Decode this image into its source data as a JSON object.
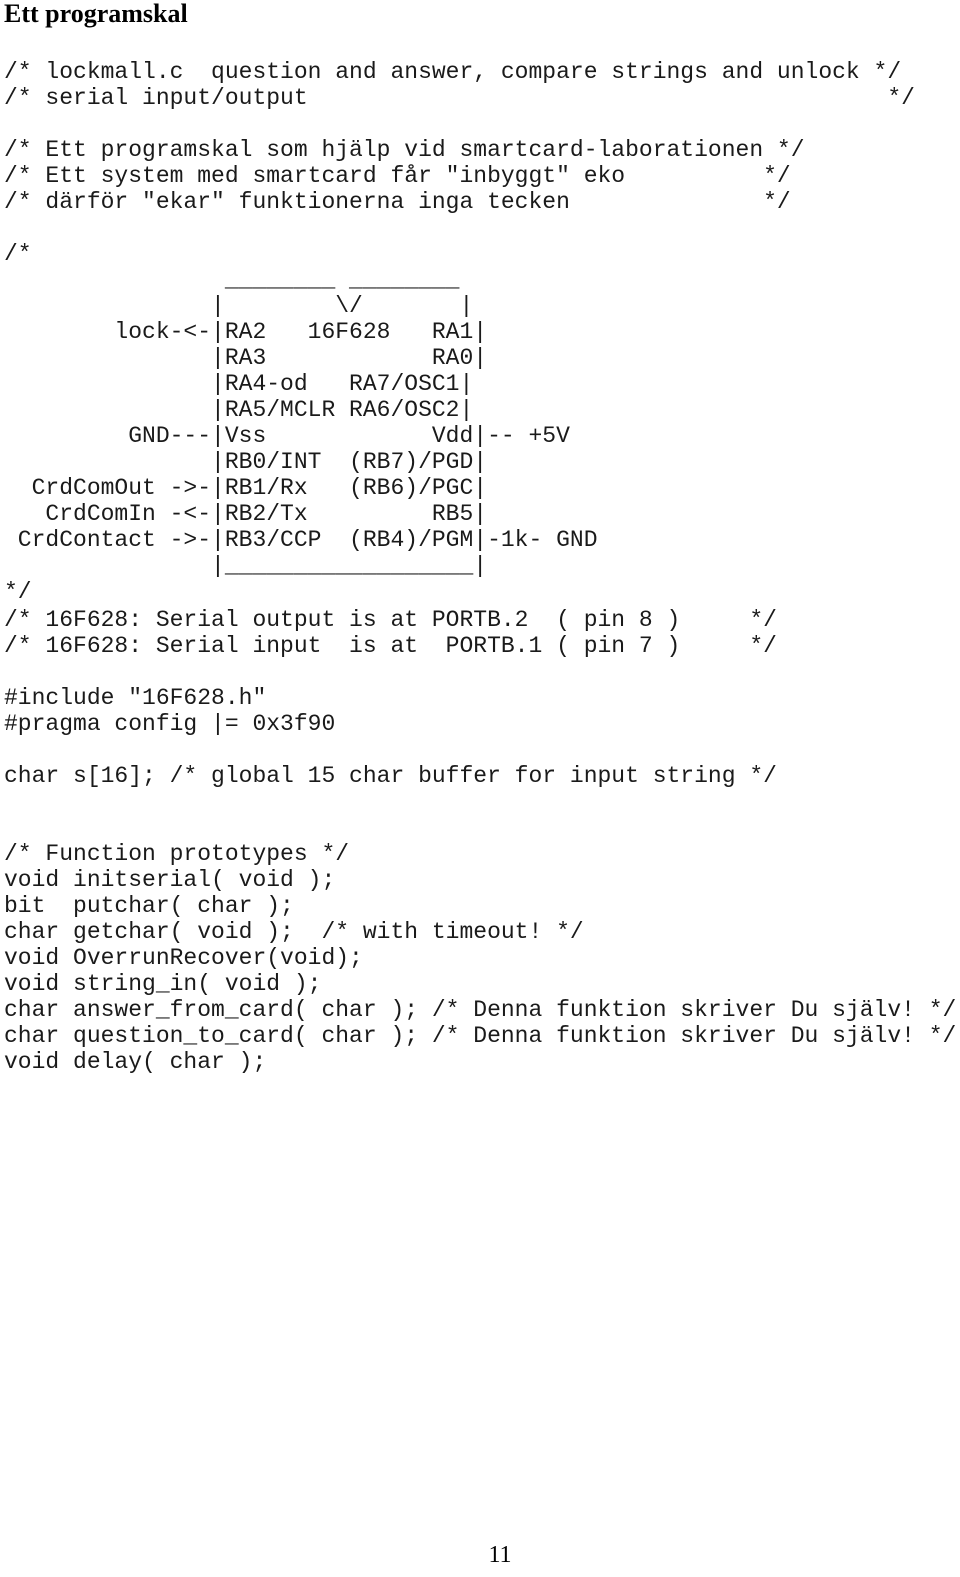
{
  "title": "Ett programskal",
  "header_comments": [
    "/* lockmall.c  question and answer, compare strings and unlock */",
    "/* serial input/output                                          */",
    "",
    "/* Ett programskal som hjälp vid smartcard-laborationen */",
    "/* Ett system med smartcard får \"inbyggt\" eko          */",
    "/* därför \"ekar\" funktionerna inga tecken              */"
  ],
  "pinout_diagram": [
    "/*",
    "                ________ ________",
    "               |        \\/       |",
    "        lock-<-|RA2   16F628   RA1|",
    "               |RA3            RA0|",
    "               |RA4-od   RA7/OSC1|",
    "               |RA5/MCLR RA6/OSC2|",
    "         GND---|Vss            Vdd|-- +5V",
    "               |RB0/INT  (RB7)/PGD|",
    "  CrdComOut ->-|RB1/Rx   (RB6)/PGC|",
    "   CrdComIn -<-|RB2/Tx         RB5|",
    " CrdContact ->-|RB3/CCP  (RB4)/PGM|-1k- GND",
    "               |__________________|",
    "*/"
  ],
  "port_comments": [
    "/* 16F628: Serial output is at PORTB.2  ( pin 8 )     */",
    "/* 16F628: Serial input  is at  PORTB.1 ( pin 7 )     */"
  ],
  "preprocessor": [
    "#include \"16F628.h\"",
    "#pragma config |= 0x3f90"
  ],
  "globals": [
    "char s[16]; /* global 15 char buffer for input string */"
  ],
  "prototypes": [
    "/* Function prototypes */",
    "void initserial( void );",
    "bit  putchar( char );",
    "char getchar( void );  /* with timeout! */",
    "void OverrunRecover(void);",
    "void string_in( void );",
    "char answer_from_card( char ); /* Denna funktion skriver Du själv! */",
    "char question_to_card( char ); /* Denna funktion skriver Du själv! */",
    "void delay( char );"
  ],
  "page_number": "11"
}
